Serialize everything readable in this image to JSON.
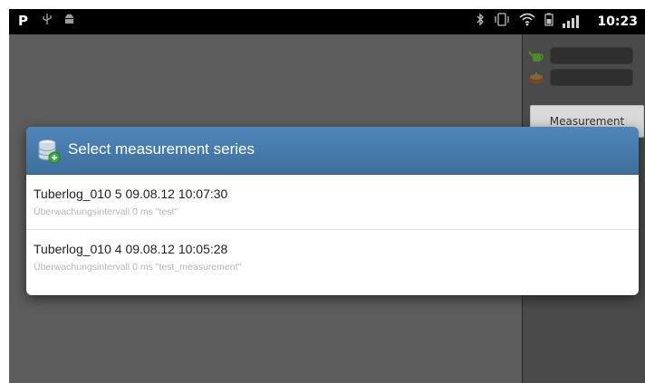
{
  "status_bar": {
    "left_icons": [
      "p-icon",
      "usb-icon",
      "android-icon"
    ],
    "left_p": "P",
    "right_icons": [
      "bluetooth-icon",
      "vibrate-icon",
      "wifi-icon",
      "battery-icon",
      "signal-icon"
    ],
    "time": "10:23"
  },
  "side_panel": {
    "icons": [
      "watering-can-icon",
      "soil-icon"
    ],
    "tab_label": "Measurement"
  },
  "dialog": {
    "title": "Select measurement series",
    "icon": "database-icon",
    "items": [
      {
        "title": "Tuberlog_010 5 09.08.12 10:07:30",
        "subtitle": "Überwachungsintervall 0 ms \"test\""
      },
      {
        "title": "Tuberlog_010 4 09.08.12 10:05:28",
        "subtitle": "Überwachungsintervall 0 ms \"test_measurement\""
      }
    ]
  },
  "colors": {
    "dialog_header": "#4a7fb2",
    "background": "#5d5d5d",
    "status_bar": "#000000"
  }
}
